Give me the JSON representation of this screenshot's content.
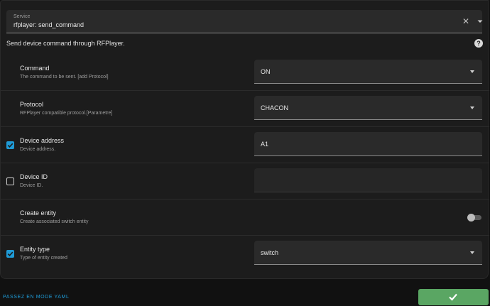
{
  "service": {
    "label": "Service",
    "value": "rfplayer: send_command",
    "description": "Send device command through RFPlayer."
  },
  "fields": [
    {
      "title": "Command",
      "subtitle": "The command to be sent. [add Protocol]",
      "checked": null,
      "control": "select",
      "value": "ON"
    },
    {
      "title": "Protocol",
      "subtitle": "RFPlayer compatible protocol.[Parametre]",
      "checked": null,
      "control": "select",
      "value": "CHACON"
    },
    {
      "title": "Device address",
      "subtitle": "Device address.",
      "checked": true,
      "control": "text",
      "value": "A1"
    },
    {
      "title": "Device ID",
      "subtitle": "Device ID.",
      "checked": false,
      "control": "text",
      "value": ""
    },
    {
      "title": "Create entity",
      "subtitle": "Create associated switch entity",
      "checked": null,
      "control": "toggle",
      "value": "off"
    },
    {
      "title": "Entity type",
      "subtitle": "Type of entity created",
      "checked": true,
      "control": "select",
      "value": "switch"
    }
  ],
  "footer": {
    "yaml_link": "PASSEZ EN MODE YAML"
  },
  "icons": {
    "clear": "close-icon",
    "dropdown": "chevron-down-icon",
    "help": "help-circle-icon",
    "submit": "checkmark-icon"
  },
  "colors": {
    "accent": "#1f9bd7",
    "submit": "#5aa663",
    "background": "#1c1c1c"
  }
}
